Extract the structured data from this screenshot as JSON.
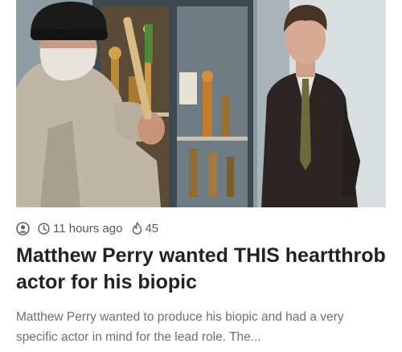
{
  "article": {
    "title": "Matthew Perry wanted THIS heartthrob actor for his biopic",
    "excerpt": "Matthew Perry wanted to produce his biopic and had a very specific actor in mind for the lead role. The...",
    "meta": {
      "author_icon": "user-circle-icon",
      "time_icon": "clock-icon",
      "time_ago": "11 hours ago",
      "views_icon": "flame-icon",
      "views_count": "45"
    },
    "image": {
      "icon": "article-thumbnail"
    }
  },
  "colors": {
    "title": "#1f2326",
    "meta": "#555a5e",
    "excerpt": "#6c7176",
    "background": "#ffffff"
  }
}
